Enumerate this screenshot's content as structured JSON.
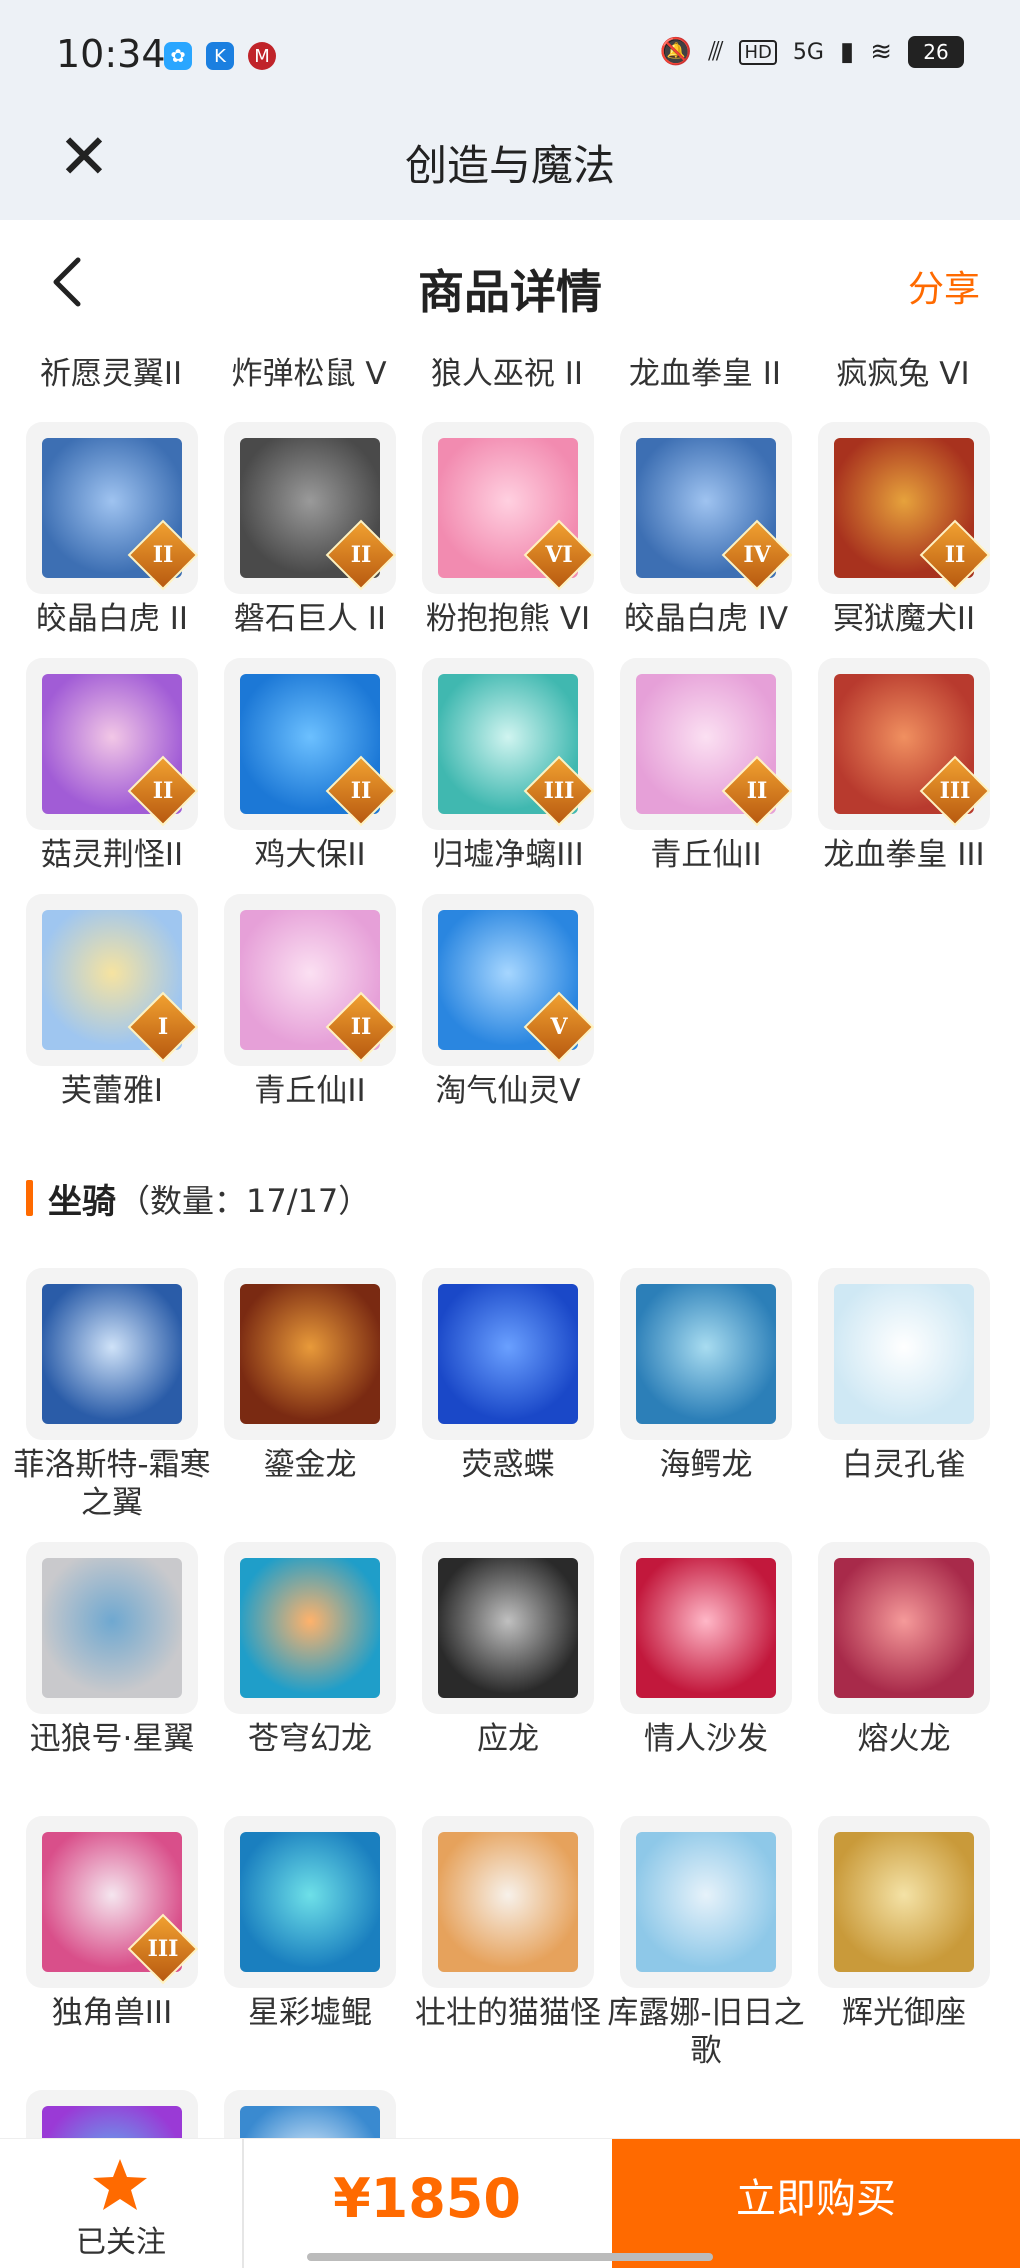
{
  "status_bar": {
    "time": "10:34",
    "signal_text": "5G",
    "battery": "26"
  },
  "app_bar": {
    "title": "创造与魔法",
    "close_icon": "close-icon"
  },
  "page_header": {
    "title": "商品详情",
    "share_label": "分享",
    "back_icon": "back-arrow-icon"
  },
  "top_row_labels": [
    "祈愿灵翼II",
    "炸弹松鼠 V",
    "狼人巫祝 II",
    "龙血拳皇 II",
    "疯疯兔 VI"
  ],
  "pets_grid": [
    {
      "name": "皎晶白虎 II",
      "rank": "II"
    },
    {
      "name": "磐石巨人 II",
      "rank": "II"
    },
    {
      "name": "粉抱抱熊 VI",
      "rank": "VI"
    },
    {
      "name": "皎晶白虎 IV",
      "rank": "IV"
    },
    {
      "name": "冥狱魔犬II",
      "rank": "II"
    },
    {
      "name": "菇灵荆怪II",
      "rank": "II"
    },
    {
      "name": "鸡大保II",
      "rank": "II"
    },
    {
      "name": "归墟净螭III",
      "rank": "III"
    },
    {
      "name": "青丘仙II",
      "rank": "II"
    },
    {
      "name": "龙血拳皇 III",
      "rank": "III"
    },
    {
      "name": "芙蕾雅I",
      "rank": "I"
    },
    {
      "name": "青丘仙II",
      "rank": "II"
    },
    {
      "name": "淘气仙灵V",
      "rank": "V"
    }
  ],
  "mounts_section": {
    "title": "坐骑",
    "count_text": "（数量：17/17）"
  },
  "mounts_grid": [
    {
      "name": "菲洛斯特-霜寒之翼"
    },
    {
      "name": "鎏金龙"
    },
    {
      "name": "荧惑蝶"
    },
    {
      "name": "海鳄龙"
    },
    {
      "name": "白灵孔雀"
    },
    {
      "name": "迅狼号·星翼"
    },
    {
      "name": "苍穹幻龙"
    },
    {
      "name": "应龙"
    },
    {
      "name": "情人沙发"
    },
    {
      "name": "熔火龙"
    },
    {
      "name": "独角兽III",
      "rank": "III"
    },
    {
      "name": "星彩墟鲲"
    },
    {
      "name": "壮壮的猫猫怪"
    },
    {
      "name": "库露娜-旧日之歌"
    },
    {
      "name": "辉光御座"
    },
    {
      "name": ""
    },
    {
      "name": ""
    }
  ],
  "bottom_bar": {
    "follow_label": "已关注",
    "price": "¥1850",
    "buy_label": "立即购买",
    "star_icon": "star-icon"
  },
  "colors": {
    "accent": "#ff6a00",
    "bar_bg": "#edf1f6"
  }
}
